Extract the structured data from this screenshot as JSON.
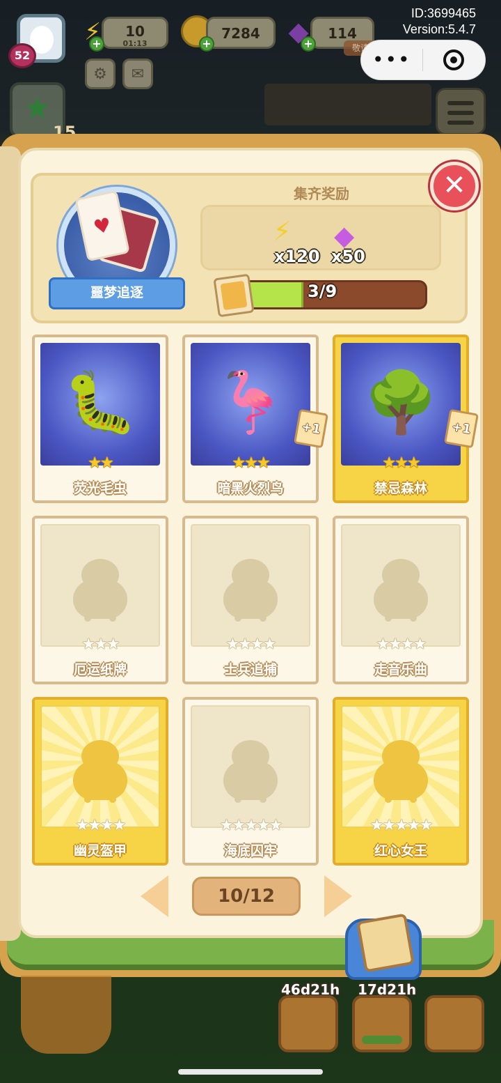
{
  "hud": {
    "level": "52",
    "energy": "10",
    "energy_timer": "01:13",
    "coins": "7284",
    "gems": "114",
    "gem_tag": "敬请期待",
    "id_line": "ID:3699465",
    "version_line": "Version:5.4.7",
    "quest_count": "15"
  },
  "album": {
    "name": "噩梦追逐",
    "reward_title": "集齐奖励",
    "reward_energy": "x120",
    "reward_gems": "x50",
    "progress_text": "3/9",
    "progress_fraction": 0.333
  },
  "cards": [
    {
      "name": "荧光毛虫",
      "stars": 2,
      "collected": true,
      "gold": false,
      "plus": "",
      "art": "🐛"
    },
    {
      "name": "暗黑火烈鸟",
      "stars": 3,
      "collected": true,
      "gold": false,
      "plus": "+1",
      "art": "🦩"
    },
    {
      "name": "禁忌森林",
      "stars": 3,
      "collected": true,
      "gold": true,
      "plus": "+1",
      "art": "🌳"
    },
    {
      "name": "厄运纸牌",
      "stars": 3,
      "collected": false,
      "gold": false,
      "plus": "",
      "art": ""
    },
    {
      "name": "士兵追捕",
      "stars": 4,
      "collected": false,
      "gold": false,
      "plus": "",
      "art": ""
    },
    {
      "name": "走音乐曲",
      "stars": 4,
      "collected": false,
      "gold": false,
      "plus": "",
      "art": ""
    },
    {
      "name": "幽灵盔甲",
      "stars": 4,
      "collected": false,
      "gold": true,
      "plus": "",
      "art": ""
    },
    {
      "name": "海底囚牢",
      "stars": 5,
      "collected": false,
      "gold": false,
      "plus": "",
      "art": ""
    },
    {
      "name": "红心女王",
      "stars": 5,
      "collected": false,
      "gold": true,
      "plus": "",
      "art": ""
    }
  ],
  "pagination": {
    "label": "10/12"
  },
  "bottom": {
    "timer_left": "46d21h",
    "timer_right": "17d21h"
  },
  "colors": {
    "accent_blue": "#5c9de3",
    "progress_green": "#b5e44a",
    "close_red": "#e8505a"
  },
  "icons": {
    "energy": "lightning-icon",
    "coins": "coin-icon",
    "gems": "gem-icon",
    "close": "close-icon",
    "prev": "chevron-left-icon",
    "next": "chevron-right-icon"
  }
}
